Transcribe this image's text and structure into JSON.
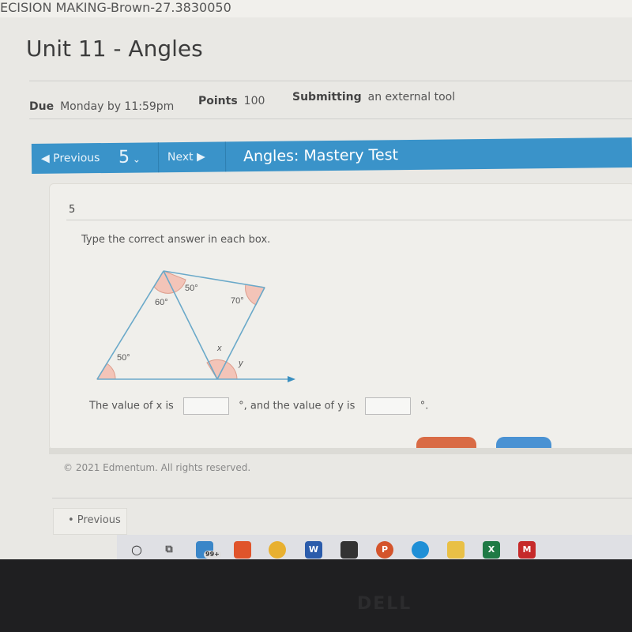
{
  "browser": {
    "tab_title": "ECISION MAKING-Brown-27.3830050"
  },
  "assignment": {
    "title": "Unit 11 - Angles",
    "due_label": "Due",
    "due_value": "Monday by 11:59pm",
    "points_label": "Points",
    "points_value": "100",
    "submitting_label": "Submitting",
    "submitting_value": "an external tool"
  },
  "navbar": {
    "previous_label": "Previous",
    "question_number": "5",
    "next_label": "Next",
    "test_title": "Angles: Mastery Test",
    "color": "#3a93c9"
  },
  "question": {
    "number": "5",
    "prompt": "Type the correct answer in each box.",
    "diagram_labels": {
      "top_right_of_vertex": "50°",
      "top_left_of_vertex": "60°",
      "right_vertex": "70°",
      "bottom_left": "50°",
      "x": "x",
      "y": "y"
    },
    "answer_prefix": "The value of x is",
    "answer_middle": "°, and the value of y is",
    "answer_suffix": "°.",
    "x_value": "",
    "y_value": ""
  },
  "footer": {
    "copyright": "© 2021 Edmentum. All rights reserved.",
    "previous_label": "• Previous"
  },
  "taskbar": {
    "mail_badge": "99+",
    "icons": [
      "cortana-icon",
      "task-view-icon",
      "mail-icon",
      "office-icon",
      "chrome-icon",
      "word-icon",
      "store-icon",
      "powerpoint-icon",
      "edge-icon",
      "file-explorer-icon",
      "excel-icon",
      "mcafee-icon"
    ]
  },
  "bezel": {
    "brand": "DELL"
  }
}
